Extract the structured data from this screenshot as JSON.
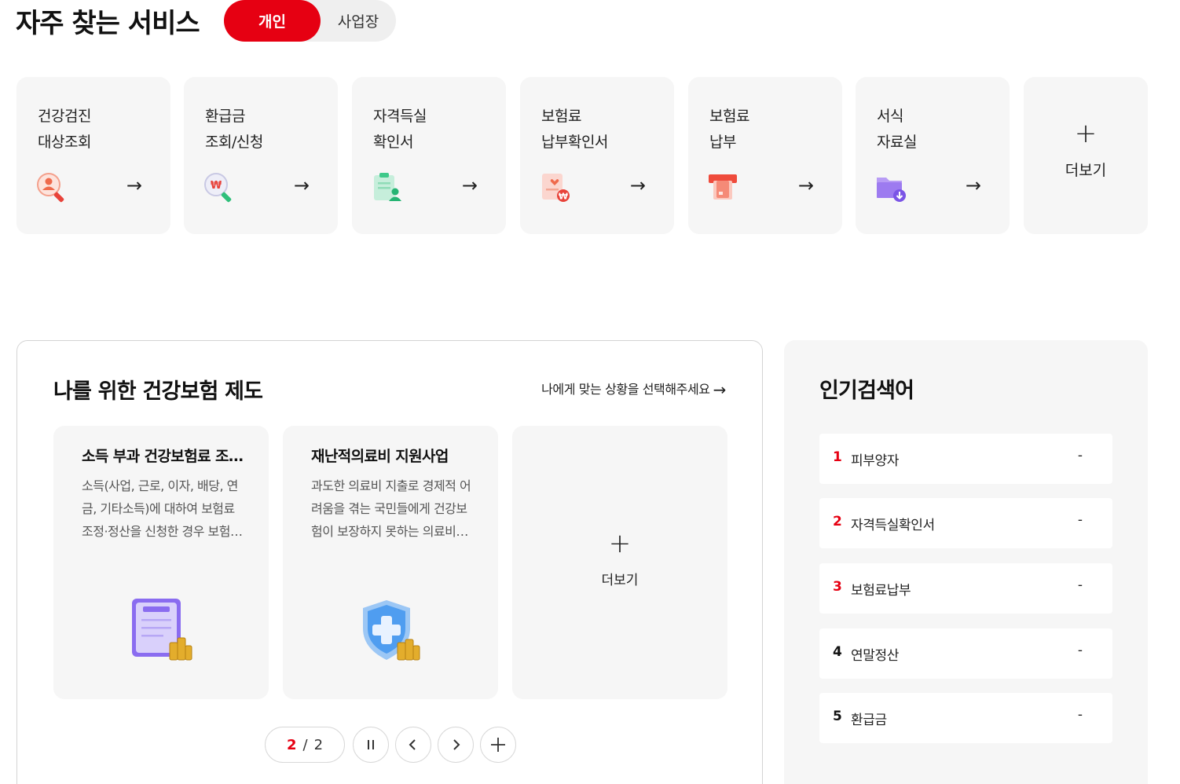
{
  "header": {
    "title": "자주 찾는 서비스",
    "toggle": {
      "active": "개인",
      "inactive": "사업장"
    }
  },
  "services": [
    {
      "label": "건강검진\n대상조회",
      "icon": "person-search-icon"
    },
    {
      "label": "환급금\n조회/신청",
      "icon": "won-search-icon"
    },
    {
      "label": "자격득실\n확인서",
      "icon": "clipboard-person-icon"
    },
    {
      "label": "보험료\n납부확인서",
      "icon": "receipt-won-icon"
    },
    {
      "label": "보험료\n납부",
      "icon": "atm-card-icon"
    },
    {
      "label": "서식\n자료실",
      "icon": "folder-download-icon"
    }
  ],
  "services_more": {
    "plus": "+",
    "label": "더보기"
  },
  "arrow": "→",
  "panel": {
    "title": "나를 위한 건강보험 제도",
    "link": "나에게 맞는 상황을 선택해주세요",
    "link_arrow": "→",
    "cards": [
      {
        "title": "소득 부과 건강보험료 조정·정산 신청",
        "desc": "소득(사업, 근로, 이자, 배당, 연금, 기타소득)에 대하여 보험료 조정·정산을 신청한 경우 보험료를 조정하는 제도",
        "illus": "clipboard-coins-icon"
      },
      {
        "title": "재난적의료비 지원사업",
        "desc": "과도한 의료비 지출로 경제적 어려움을 겪는 국민들에게 건강보험이 보장하지 못하는 의료비를 지원하는 제도",
        "illus": "shield-cross-coins-icon"
      }
    ],
    "more": {
      "plus": "+",
      "label": "더보기"
    },
    "pager": {
      "current": "2",
      "separator": "/",
      "total": "2"
    }
  },
  "popular": {
    "title": "인기검색어",
    "items": [
      {
        "rank": "1",
        "term": "피부양자",
        "change": "-",
        "rank_color": "#e60012"
      },
      {
        "rank": "2",
        "term": "자격득실확인서",
        "change": "-",
        "rank_color": "#e60012"
      },
      {
        "rank": "3",
        "term": "보험료납부",
        "change": "-",
        "rank_color": "#e60012"
      },
      {
        "rank": "4",
        "term": "연말정산",
        "change": "-",
        "rank_color": "#111111"
      },
      {
        "rank": "5",
        "term": "환급금",
        "change": "-",
        "rank_color": "#111111"
      }
    ]
  },
  "colors": {
    "accent": "#e60012",
    "card_bg": "#f6f6f6"
  }
}
